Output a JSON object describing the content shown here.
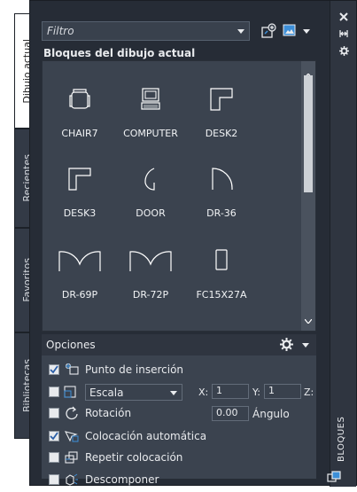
{
  "panel": {
    "title": "BLOQUES",
    "tabs": [
      {
        "label": "Dibujo actual"
      },
      {
        "label": "Recientes"
      },
      {
        "label": "Favoritos"
      },
      {
        "label": "Bibliotecas"
      }
    ]
  },
  "filter": {
    "placeholder": "Filtro"
  },
  "section_title": "Bloques del dibujo actual",
  "blocks": [
    {
      "name": "CHAIR7"
    },
    {
      "name": "COMPUTER"
    },
    {
      "name": "DESK2"
    },
    {
      "name": "DESK3"
    },
    {
      "name": "DOOR"
    },
    {
      "name": "DR-36"
    },
    {
      "name": "DR-69P"
    },
    {
      "name": "DR-72P"
    },
    {
      "name": "FC15X27A"
    }
  ],
  "options": {
    "title": "Opciones",
    "insertion_point": "Punto de inserción",
    "scale": {
      "mode": "Escala",
      "x_label": "X:",
      "x": "1",
      "y_label": "Y:",
      "y": "1",
      "z_label": "Z:"
    },
    "rotation": {
      "label": "Rotación",
      "angle": "0.00",
      "angle_label": "Ángulo"
    },
    "auto_placement": "Colocación automática",
    "repeat_placement": "Repetir colocación",
    "explode": "Descomponer"
  },
  "colors": {
    "window_bg": "#262c36",
    "gallery_bg": "#3b434f",
    "accent_blue": "#3d8fd8",
    "text": "#e8eaed"
  }
}
